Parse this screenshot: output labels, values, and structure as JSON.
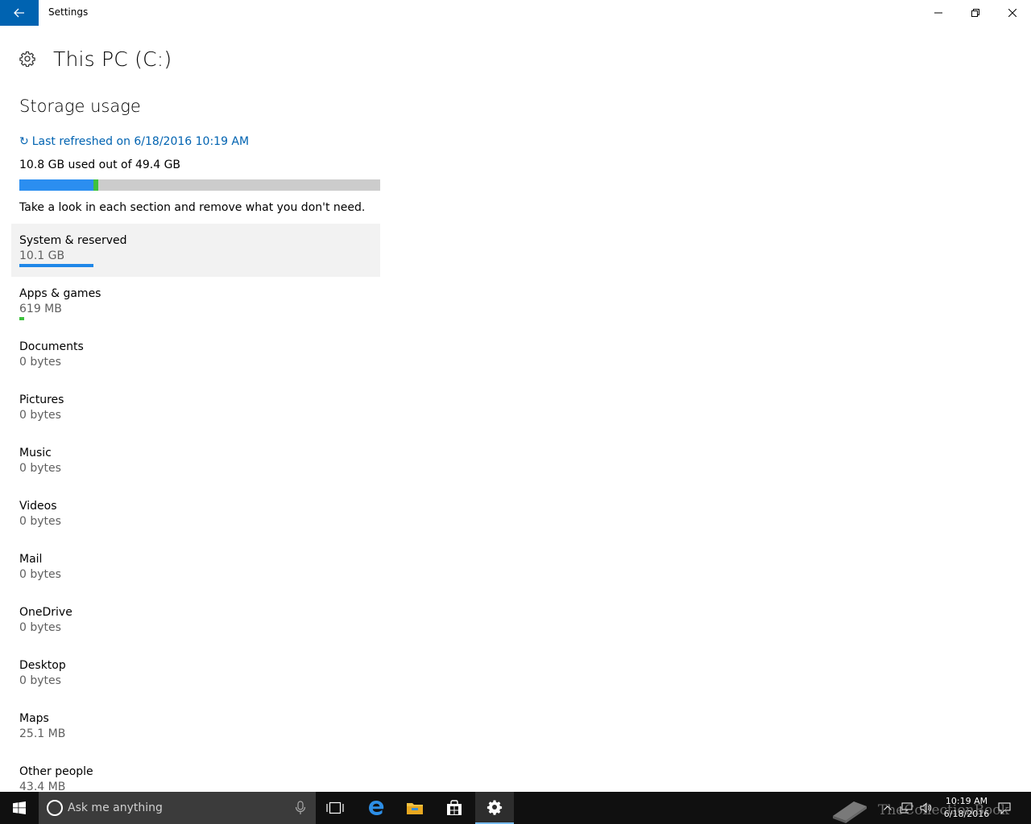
{
  "window": {
    "title": "Settings"
  },
  "header": {
    "title": "This PC (C:)"
  },
  "storage": {
    "section_title": "Storage usage",
    "refresh_text": "Last refreshed on 6/18/2016 10:19 AM",
    "used_text": "10.8 GB used out of 49.4 GB",
    "usage": {
      "total_gb": 49.4,
      "system_gb": 10.1,
      "apps_gb": 0.619,
      "colors": {
        "system": "#2b8ef0",
        "apps": "#3ec13e",
        "free": "#cccccc"
      }
    },
    "hint": "Take a look in each section and remove what you don't need.",
    "items": [
      {
        "name": "System & reserved",
        "size": "10.1 GB",
        "fraction": 1.0,
        "color": "#1f87e8",
        "selected": true
      },
      {
        "name": "Apps & games",
        "size": "619 MB",
        "fraction": 0.06,
        "color": "#3ec13e"
      },
      {
        "name": "Documents",
        "size": "0 bytes"
      },
      {
        "name": "Pictures",
        "size": "0 bytes"
      },
      {
        "name": "Music",
        "size": "0 bytes"
      },
      {
        "name": "Videos",
        "size": "0 bytes"
      },
      {
        "name": "Mail",
        "size": "0 bytes"
      },
      {
        "name": "OneDrive",
        "size": "0 bytes"
      },
      {
        "name": "Desktop",
        "size": "0 bytes"
      },
      {
        "name": "Maps",
        "size": "25.1 MB"
      },
      {
        "name": "Other people",
        "size": "43.4 MB"
      }
    ]
  },
  "taskbar": {
    "search_placeholder": "Ask me anything",
    "clock_time": "10:19 AM",
    "clock_date": "6/18/2016",
    "watermark": "TheCollectionBook",
    "accent_color": "#76b9ed"
  },
  "colors": {
    "accent": "#0063b1",
    "selected_bg": "#f2f2f2"
  }
}
